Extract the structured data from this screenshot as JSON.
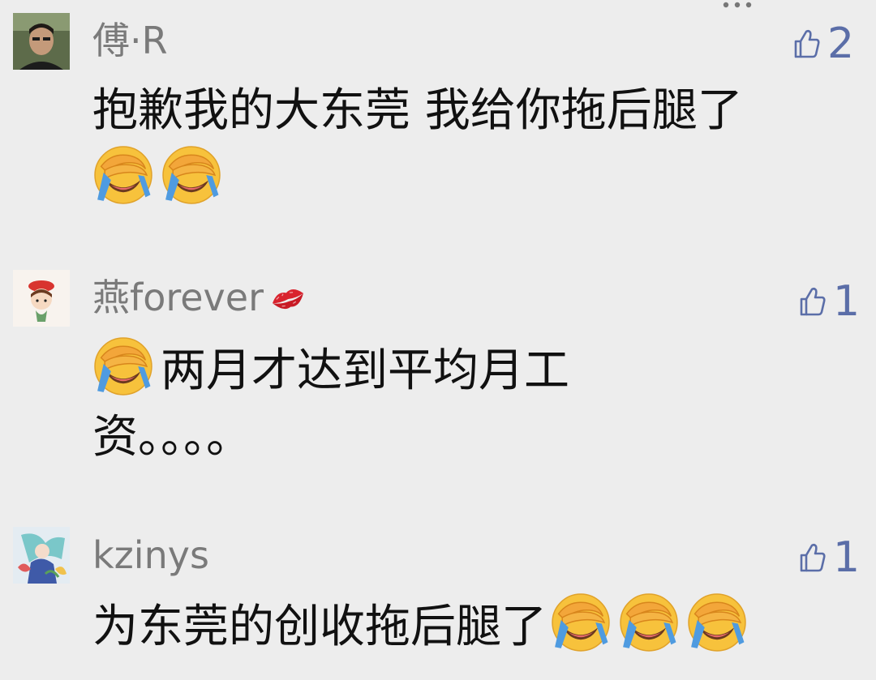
{
  "comments": [
    {
      "username": "傅·R",
      "text_line1": "抱歉我的大东莞 我给你拖后腿了",
      "likes": "2",
      "avatar_icon": "man-portrait-avatar",
      "emoji": "face-palm-laugh-emoji",
      "more_icon": "more-dots-icon"
    },
    {
      "username": "燕forever",
      "username_suffix_icon": "kiss-lips-icon",
      "text_line1": "两月才达到平均月工",
      "text_line2": "资。。。。",
      "likes": "1",
      "avatar_icon": "cartoon-girl-red-hat-avatar",
      "emoji": "face-palm-laugh-emoji"
    },
    {
      "username": "kzinys",
      "text_line1": "为东莞的创收拖后腿了",
      "likes": "1",
      "avatar_icon": "anime-character-avatar",
      "emoji": "face-palm-laugh-emoji"
    }
  ],
  "colors": {
    "background": "#ededed",
    "username": "#7a7a7a",
    "text": "#111111",
    "like_accent": "#5b6ea8"
  }
}
